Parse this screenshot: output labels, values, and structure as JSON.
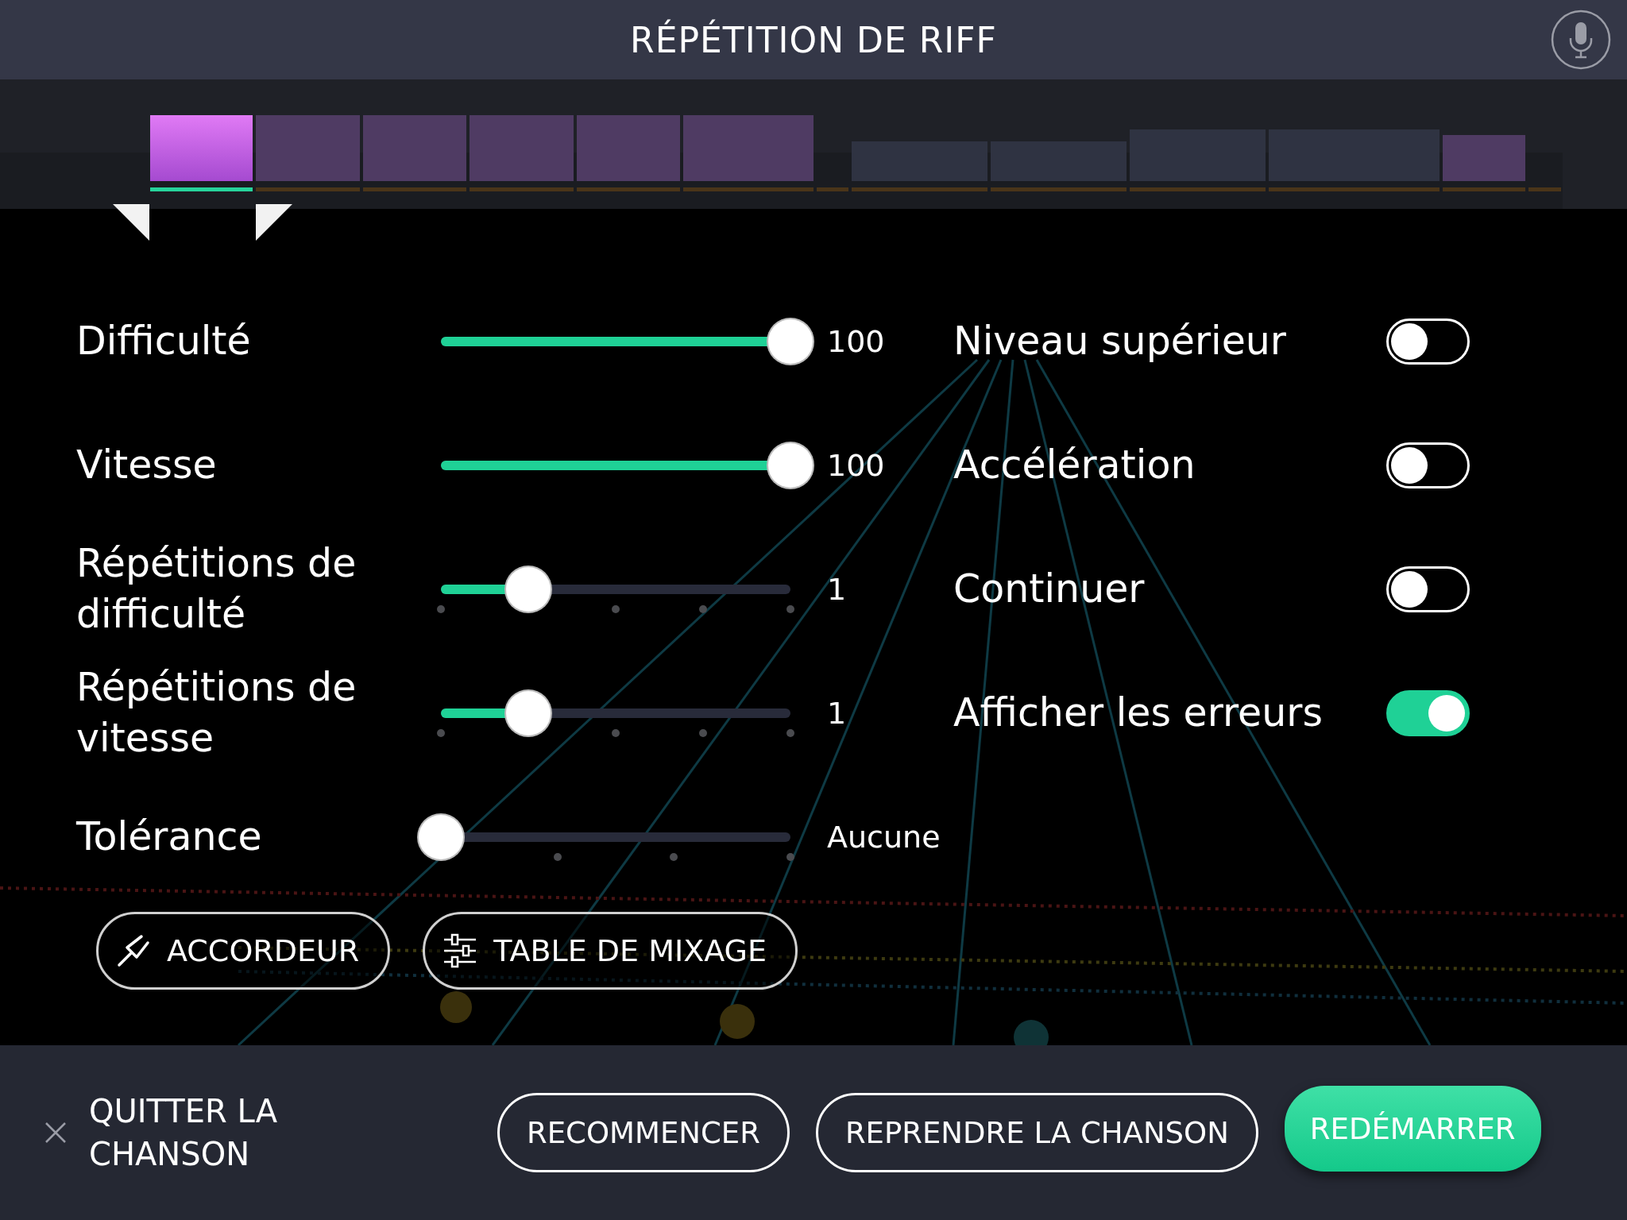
{
  "header": {
    "title": "RÉPÉTITION DE RIFF"
  },
  "timeline": {
    "sections": [
      {
        "kind": "riff",
        "selected": true
      },
      {
        "kind": "riff",
        "selected": false
      },
      {
        "kind": "riff",
        "selected": false
      },
      {
        "kind": "riff",
        "selected": false
      },
      {
        "kind": "riff",
        "selected": false
      },
      {
        "kind": "riff",
        "selected": false
      },
      {
        "kind": "gap",
        "selected": false
      },
      {
        "kind": "other",
        "selected": false
      },
      {
        "kind": "other",
        "selected": false
      },
      {
        "kind": "other",
        "selected": false
      },
      {
        "kind": "other",
        "selected": false
      },
      {
        "kind": "riff",
        "selected": false
      },
      {
        "kind": "gap",
        "selected": false
      }
    ]
  },
  "sliders": [
    {
      "label": "Difficulté",
      "kind": "plain",
      "level": 1,
      "reading": "100"
    },
    {
      "label": "Vitesse",
      "kind": "plain",
      "level": 1,
      "reading": "100"
    },
    {
      "label": "Répétitions de difficulté",
      "kind": "five-step",
      "level": 0.25,
      "reading": "1"
    },
    {
      "label": "Répétitions de vitesse",
      "kind": "five-step",
      "level": 0.25,
      "reading": "1"
    },
    {
      "label": "Tolérance",
      "kind": "four-step",
      "level": 0,
      "reading": "Aucune"
    }
  ],
  "toggles": [
    {
      "label": "Niveau supérieur",
      "on": false
    },
    {
      "label": "Accélération",
      "on": false
    },
    {
      "label": "Continuer",
      "on": false
    },
    {
      "label": "Afficher les erreurs",
      "on": true
    }
  ],
  "tools": [
    {
      "kind": "tuner",
      "label": "ACCORDEUR"
    },
    {
      "kind": "mixer",
      "label": "TABLE DE MIXAGE"
    }
  ],
  "footer": {
    "quit": "QUITTER LA CHANSON",
    "buttons": [
      {
        "kind": "outline",
        "label": "RECOMMENCER"
      },
      {
        "kind": "outline",
        "label": "REPRENDRE LA CHANSON"
      },
      {
        "kind": "primary",
        "label": "REDÉMARRER"
      }
    ]
  }
}
